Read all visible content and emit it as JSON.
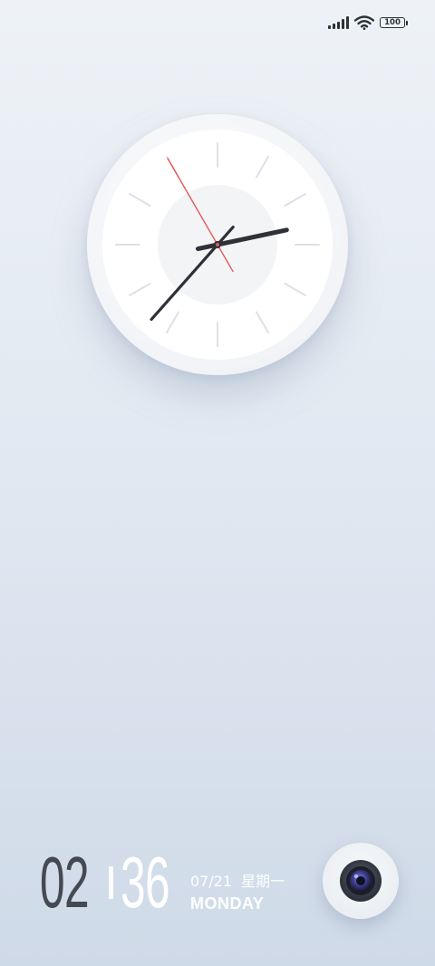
{
  "status_bar": {
    "battery": "100",
    "icons": [
      "signal-icon",
      "wifi-icon",
      "battery-icon"
    ]
  },
  "analog_clock": {
    "hour": 2,
    "minute": 36,
    "second": 55,
    "colors": {
      "hands": "#2e3138",
      "second_hand": "#e25a5a",
      "face": "#ffffff",
      "ticks": "#dde1e7"
    }
  },
  "lock_time": {
    "hours": "02",
    "minutes": "36"
  },
  "date": {
    "numeric": "07/21",
    "weekday_cn": "星期一",
    "weekday_en": "MONDAY"
  },
  "camera": {
    "icon": "camera-icon"
  }
}
